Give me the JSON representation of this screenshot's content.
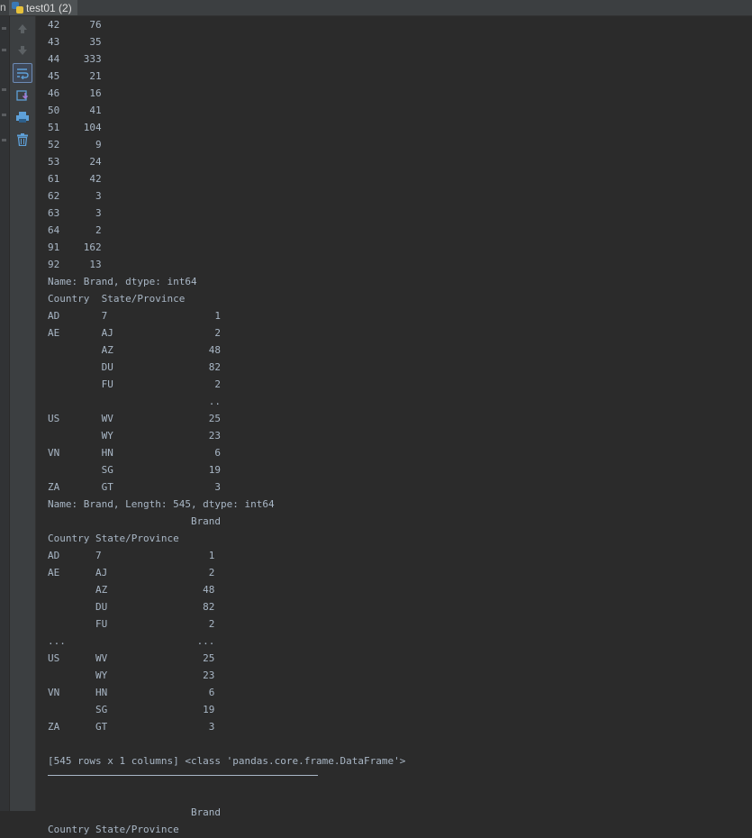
{
  "tab": {
    "left_fragment": "n",
    "title": "test01 (2)",
    "icon": "python-file-icon"
  },
  "toolbar": {
    "buttons": [
      {
        "name": "scroll-up-icon"
      },
      {
        "name": "scroll-down-icon"
      },
      {
        "name": "soft-wrap-icon",
        "active": true
      },
      {
        "name": "scroll-to-end-icon"
      },
      {
        "name": "print-icon"
      },
      {
        "name": "clear-all-icon"
      }
    ]
  },
  "console": {
    "lines": [
      "42     76",
      "43     35",
      "44    333",
      "45     21",
      "46     16",
      "50     41",
      "51    104",
      "52      9",
      "53     24",
      "61     42",
      "62      3",
      "63      3",
      "64      2",
      "91    162",
      "92     13",
      "Name: Brand, dtype: int64",
      "Country  State/Province",
      "AD       7                  1",
      "AE       AJ                 2",
      "         AZ                48",
      "         DU                82",
      "         FU                 2",
      "                           ..",
      "US       WV                25",
      "         WY                23",
      "VN       HN                 6",
      "         SG                19",
      "ZA       GT                 3",
      "Name: Brand, Length: 545, dtype: int64",
      "                        Brand",
      "Country State/Province",
      "AD      7                  1",
      "AE      AJ                 2",
      "        AZ                48",
      "        DU                82",
      "        FU                 2",
      "...                      ...",
      "US      WV                25",
      "        WY                23",
      "VN      HN                 6",
      "        SG                19",
      "ZA      GT                 3",
      "",
      "[545 rows x 1 columns] <class 'pandas.core.frame.DataFrame'>"
    ],
    "after_divider": [
      "",
      "                        Brand",
      "Country State/Province"
    ]
  }
}
